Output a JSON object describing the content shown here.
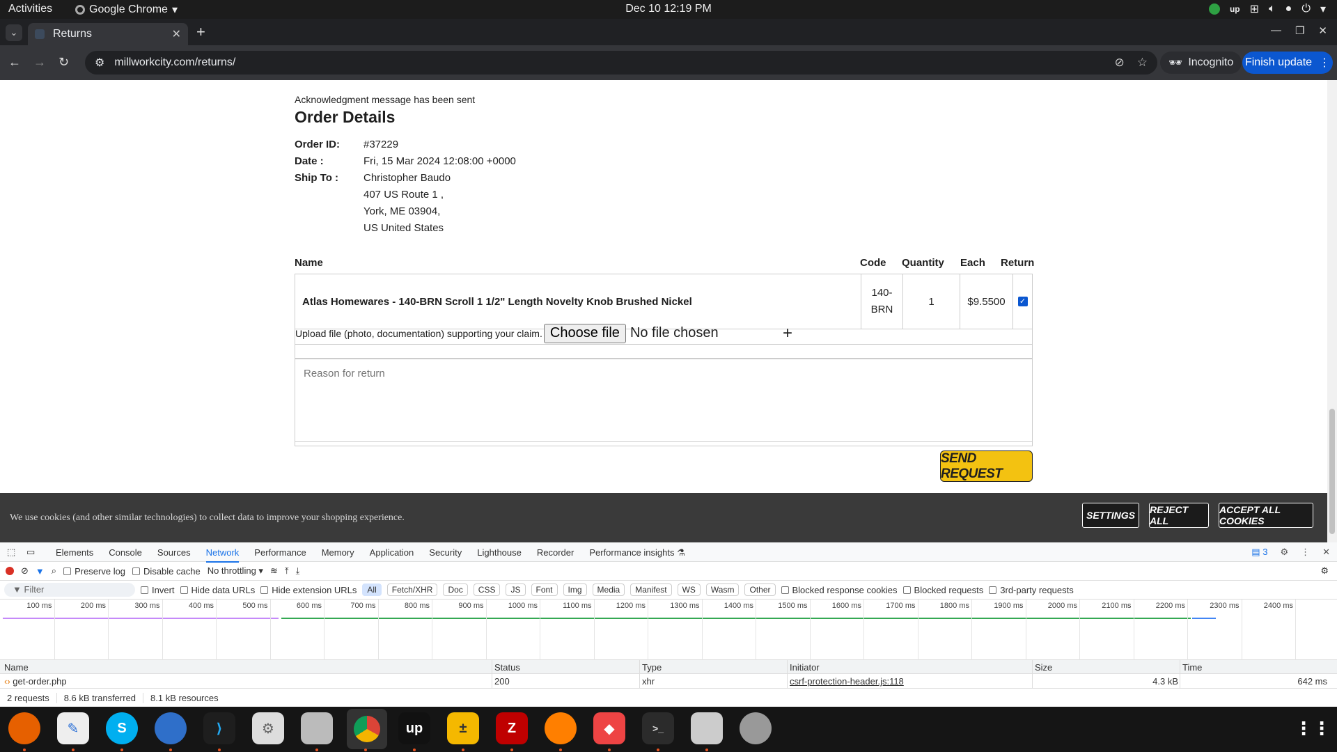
{
  "system_bar": {
    "activities": "Activities",
    "app_name": "Google Chrome",
    "clock": "Dec 10  12:19 PM"
  },
  "browser": {
    "tab_title": "Returns",
    "url": "millworkcity.com/returns/",
    "incognito_label": "Incognito",
    "finish_update_label": "Finish update"
  },
  "order": {
    "ack_message": "Acknowledgment message has been sent",
    "heading": "Order Details",
    "order_id_label": "Order ID:",
    "order_id": "#37229",
    "date_label": "Date :",
    "date": "Fri, 15 Mar 2024 12:08:00 +0000",
    "ship_to_label": "Ship To :",
    "ship_name": "Christopher Baudo",
    "ship_street": "407 US Route 1 ,",
    "ship_city": "York, ME 03904,",
    "ship_country": "US United States"
  },
  "items_table": {
    "headers": {
      "name": "Name",
      "code": "Code",
      "quantity": "Quantity",
      "each": "Each",
      "return": "Return"
    },
    "row": {
      "name": "Atlas Homewares - 140-BRN Scroll 1 1/2\" Length Novelty Knob Brushed Nickel",
      "code_line1": "140-",
      "code_line2": "BRN",
      "quantity": "1",
      "each": "$9.5500",
      "return_checked": true
    }
  },
  "upload": {
    "label": "Upload file (photo, documentation) supporting your claim.",
    "button": "Choose file",
    "status": "No file chosen",
    "add": "+"
  },
  "reason": {
    "placeholder": "Reason for return"
  },
  "send_button": "SEND REQUEST",
  "cookie_banner": {
    "text": "We use cookies (and other similar technologies) to collect data to improve your shopping experience.",
    "settings": "SETTINGS",
    "reject": "REJECT ALL",
    "accept": "ACCEPT ALL COOKIES"
  },
  "devtools": {
    "tabs": [
      "Elements",
      "Console",
      "Sources",
      "Network",
      "Performance",
      "Memory",
      "Application",
      "Security",
      "Lighthouse",
      "Recorder",
      "Performance insights ⚗"
    ],
    "selected_tab": "Network",
    "issues_count": "3",
    "preserve_log": "Preserve log",
    "disable_cache": "Disable cache",
    "throttling": "No throttling",
    "filter_placeholder": "Filter",
    "invert": "Invert",
    "hide_data_urls": "Hide data URLs",
    "hide_extension_urls": "Hide extension URLs",
    "type_chips": [
      "All",
      "Fetch/XHR",
      "Doc",
      "CSS",
      "JS",
      "Font",
      "Img",
      "Media",
      "Manifest",
      "WS",
      "Wasm",
      "Other"
    ],
    "selected_chip": "All",
    "blocked_response_cookies": "Blocked response cookies",
    "blocked_requests": "Blocked requests",
    "third_party": "3rd-party requests",
    "timeline_ticks": [
      "100 ms",
      "200 ms",
      "300 ms",
      "400 ms",
      "500 ms",
      "600 ms",
      "700 ms",
      "800 ms",
      "900 ms",
      "1000 ms",
      "1100 ms",
      "1200 ms",
      "1300 ms",
      "1400 ms",
      "1500 ms",
      "1600 ms",
      "1700 ms",
      "1800 ms",
      "1900 ms",
      "2000 ms",
      "2100 ms",
      "2200 ms",
      "2300 ms",
      "2400 ms"
    ],
    "columns": {
      "name": "Name",
      "status": "Status",
      "type": "Type",
      "initiator": "Initiator",
      "size": "Size",
      "time": "Time"
    },
    "request": {
      "name": "get-order.php",
      "status": "200",
      "type": "xhr",
      "initiator": "csrf-protection-header.js:118",
      "size": "4.3 kB",
      "time": "642 ms"
    },
    "summary": {
      "requests": "2 requests",
      "transferred": "8.6 kB transferred",
      "resources": "8.1 kB resources"
    }
  },
  "colors": {
    "send_button": "#f3c211",
    "chrome_dark": "#35363a",
    "finish_update": "#0b57d0",
    "cookie_bg": "#3a3a3a",
    "devtools_accent": "#1a73e8"
  }
}
